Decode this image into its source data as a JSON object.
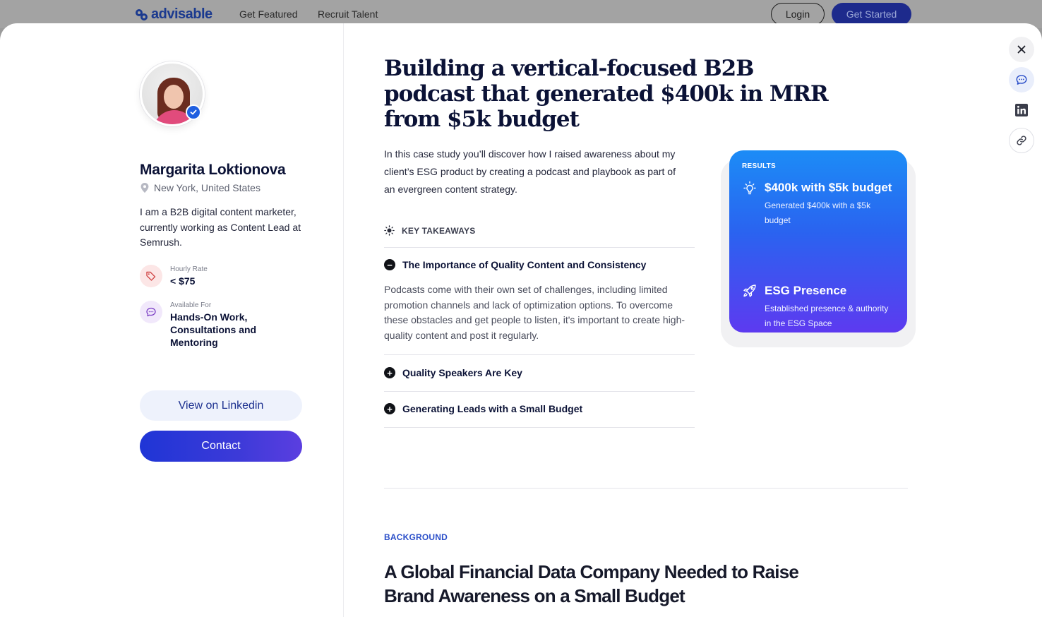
{
  "nav": {
    "brand": "advisable",
    "links": [
      "Get Featured",
      "Recruit Talent"
    ],
    "login": "Login",
    "get_started": "Get Started"
  },
  "profile": {
    "name": "Margarita Loktionova",
    "location": "New York, United States",
    "bio": "I am a B2B digital content marketer, currently working as Content Lead at Semrush.",
    "hourly_rate_label": "Hourly Rate",
    "hourly_rate_value": "< $75",
    "available_label": "Available For",
    "available_value": "Hands-On Work, Consultations and Mentoring",
    "linkedin_button": "View on Linkedin",
    "contact_button": "Contact"
  },
  "case_study": {
    "title": "Building a vertical-focused B2B podcast that generated $400k in MRR from $5k budget",
    "intro": "In this case study you’ll discover how I raised awareness about my client’s ESG product by creating a podcast and playbook as part of an evergreen content strategy.",
    "key_takeaways_label": "KEY TAKEAWAYS",
    "takeaways": [
      {
        "title": "The Importance of Quality Content and Consistency",
        "expanded": true,
        "body": "Podcasts come with their own set of challenges, including limited promotion channels and lack of optimization options. To overcome these obstacles and get people to listen, it's important to create high-quality content and post it regularly."
      },
      {
        "title": "Quality Speakers Are Key",
        "expanded": false
      },
      {
        "title": "Generating Leads with a Small Budget",
        "expanded": false
      }
    ],
    "results": {
      "label": "RESULTS",
      "items": [
        {
          "icon": "lightbulb-icon",
          "title": "$400k with $5k budget",
          "desc": "Generated $400k with a $5k budget"
        },
        {
          "icon": "rocket-icon",
          "title": "ESG Presence",
          "desc": "Established presence & authority in the ESG Space"
        }
      ]
    },
    "background_label": "BACKGROUND",
    "background_title": "A Global Financial Data Company Needed to Raise Brand Awareness on a Small Budget"
  },
  "colors": {
    "navy_text": "#0b1236",
    "brand_blue": "#1b3a8f",
    "contact_gradient_start": "#1f35d6",
    "contact_gradient_end": "#5b3ee0",
    "results_gradient_top": "#1c8cf6",
    "results_gradient_bottom": "#5d3af0",
    "background_label": "#2b4fc9"
  }
}
